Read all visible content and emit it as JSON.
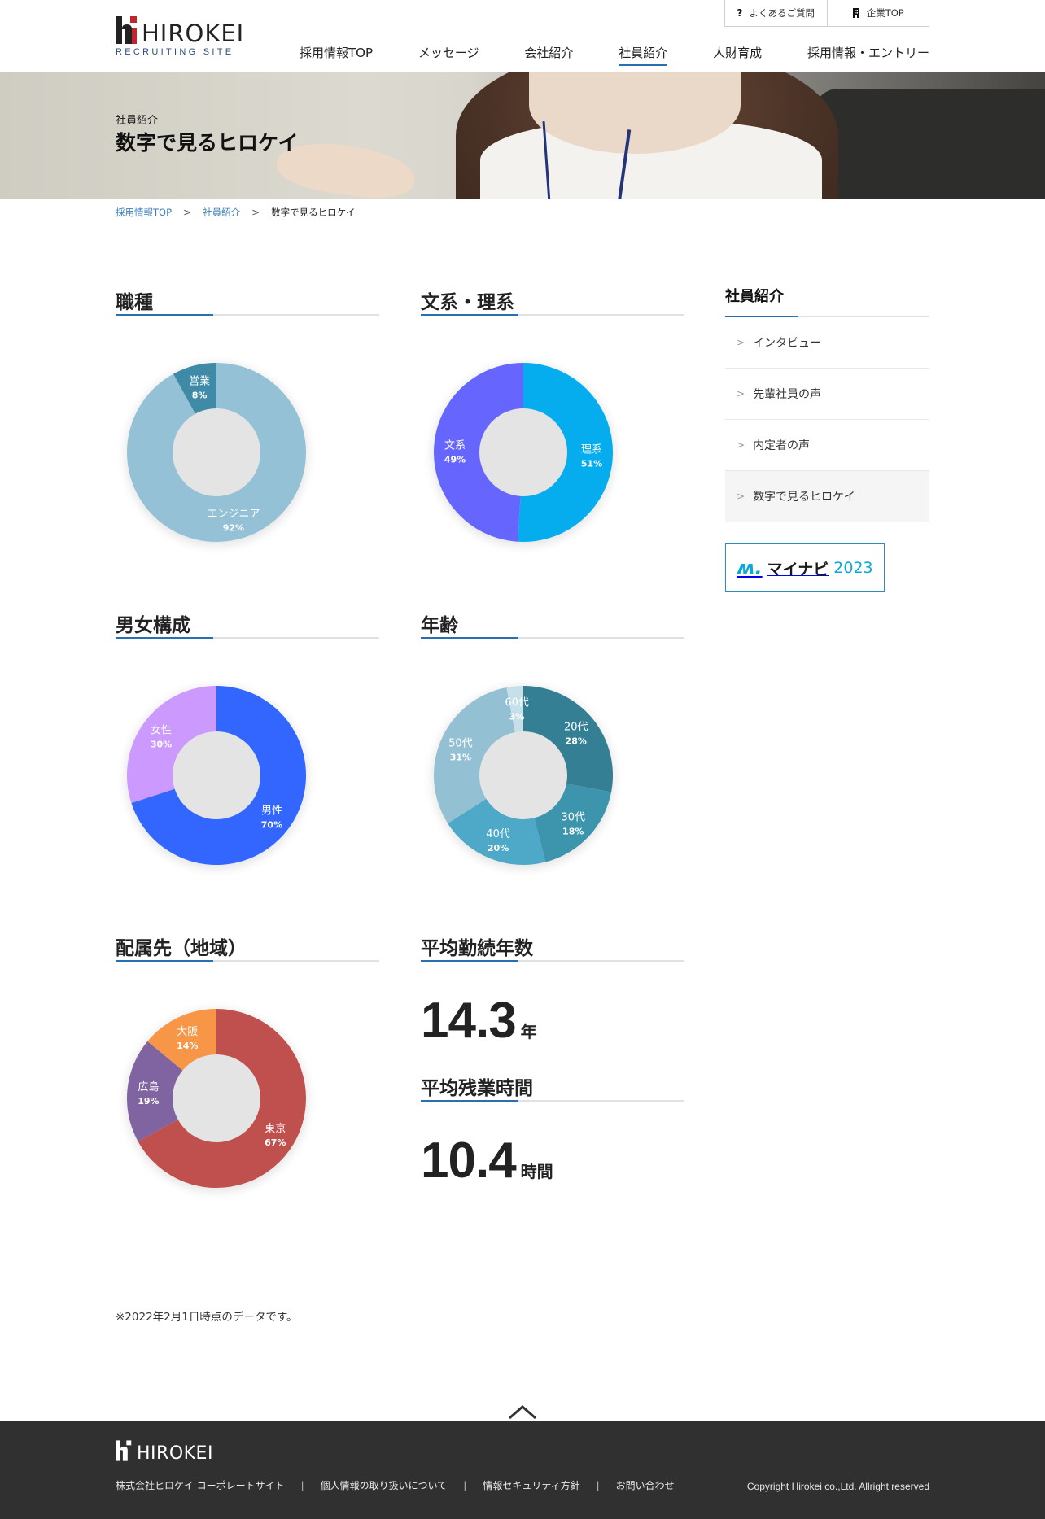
{
  "header": {
    "logo_word": "HIROKEI",
    "logo_sub": "RECRUITING SITE",
    "util_links": [
      {
        "icon": "question-icon",
        "label": "よくあるご質問"
      },
      {
        "icon": "building-icon",
        "label": "企業TOP"
      }
    ],
    "nav": [
      {
        "label": "採用情報TOP",
        "active": false
      },
      {
        "label": "メッセージ",
        "active": false
      },
      {
        "label": "会社紹介",
        "active": false
      },
      {
        "label": "社員紹介",
        "active": true
      },
      {
        "label": "人財育成",
        "active": false
      },
      {
        "label": "採用情報・エントリー",
        "active": false
      }
    ]
  },
  "hero": {
    "kicker": "社員紹介",
    "title": "数字で見るヒロケイ"
  },
  "breadcrumb": {
    "items": [
      "採用情報TOP",
      "社員紹介"
    ],
    "current": "数字で見るヒロケイ"
  },
  "sections": {
    "job": "職種",
    "field": "文系・理系",
    "gender": "男女構成",
    "age": "年齢",
    "region": "配属先（地域）",
    "tenure": "平均勤続年数",
    "overtime": "平均残業時間"
  },
  "stats": {
    "tenure": {
      "value": "14.3",
      "unit": "年"
    },
    "overtime": {
      "value": "10.4",
      "unit": "時間"
    }
  },
  "chart_data": [
    {
      "type": "pie",
      "title": "職種",
      "donut": true,
      "slices": [
        {
          "label": "エンジニア",
          "value": 92,
          "color": "#95c1d6"
        },
        {
          "label": "営業",
          "value": 8,
          "color": "#3f8aa6"
        }
      ]
    },
    {
      "type": "pie",
      "title": "文系・理系",
      "donut": true,
      "slices": [
        {
          "label": "理系",
          "value": 51,
          "color": "#06adee"
        },
        {
          "label": "文系",
          "value": 49,
          "color": "#6666ff"
        }
      ]
    },
    {
      "type": "pie",
      "title": "男女構成",
      "donut": true,
      "slices": [
        {
          "label": "男性",
          "value": 70,
          "color": "#3366ff"
        },
        {
          "label": "女性",
          "value": 30,
          "color": "#cc99ff"
        }
      ]
    },
    {
      "type": "pie",
      "title": "年齢",
      "donut": true,
      "slices": [
        {
          "label": "20代",
          "value": 28,
          "color": "#357f95"
        },
        {
          "label": "30代",
          "value": 18,
          "color": "#3d95ad"
        },
        {
          "label": "40代",
          "value": 20,
          "color": "#4ea8c7"
        },
        {
          "label": "50代",
          "value": 31,
          "color": "#93c1d3"
        },
        {
          "label": "60代",
          "value": 3,
          "color": "#c6e0ea"
        }
      ]
    },
    {
      "type": "pie",
      "title": "配属先（地域）",
      "donut": true,
      "slices": [
        {
          "label": "東京",
          "value": 67,
          "color": "#c0504d"
        },
        {
          "label": "広島",
          "value": 19,
          "color": "#8064a2"
        },
        {
          "label": "大阪",
          "value": 14,
          "color": "#f79646"
        }
      ]
    }
  ],
  "sidebar": {
    "title": "社員紹介",
    "items": [
      {
        "label": "インタビュー",
        "active": false
      },
      {
        "label": "先輩社員の声",
        "active": false
      },
      {
        "label": "内定者の声",
        "active": false
      },
      {
        "label": "数字で見るヒロケイ",
        "active": true
      }
    ],
    "banner": {
      "mark": "ʍ.",
      "name": "マイナビ",
      "year": "2023"
    }
  },
  "note": "※2022年2月1日時点のデータです。",
  "footer": {
    "logo_word": "HIROKEI",
    "links": [
      "株式会社ヒロケイ コーポレートサイト",
      "個人情報の取り扱いについて",
      "情報セキュリティ方針",
      "お問い合わせ"
    ],
    "copyright": "Copyright Hirokei co.,Ltd. Allright reserved"
  },
  "colors": {
    "accent": "#2a6fb0",
    "footer_bg": "#303031",
    "link": "#3c7db5",
    "logo_red": "#c0262d"
  }
}
